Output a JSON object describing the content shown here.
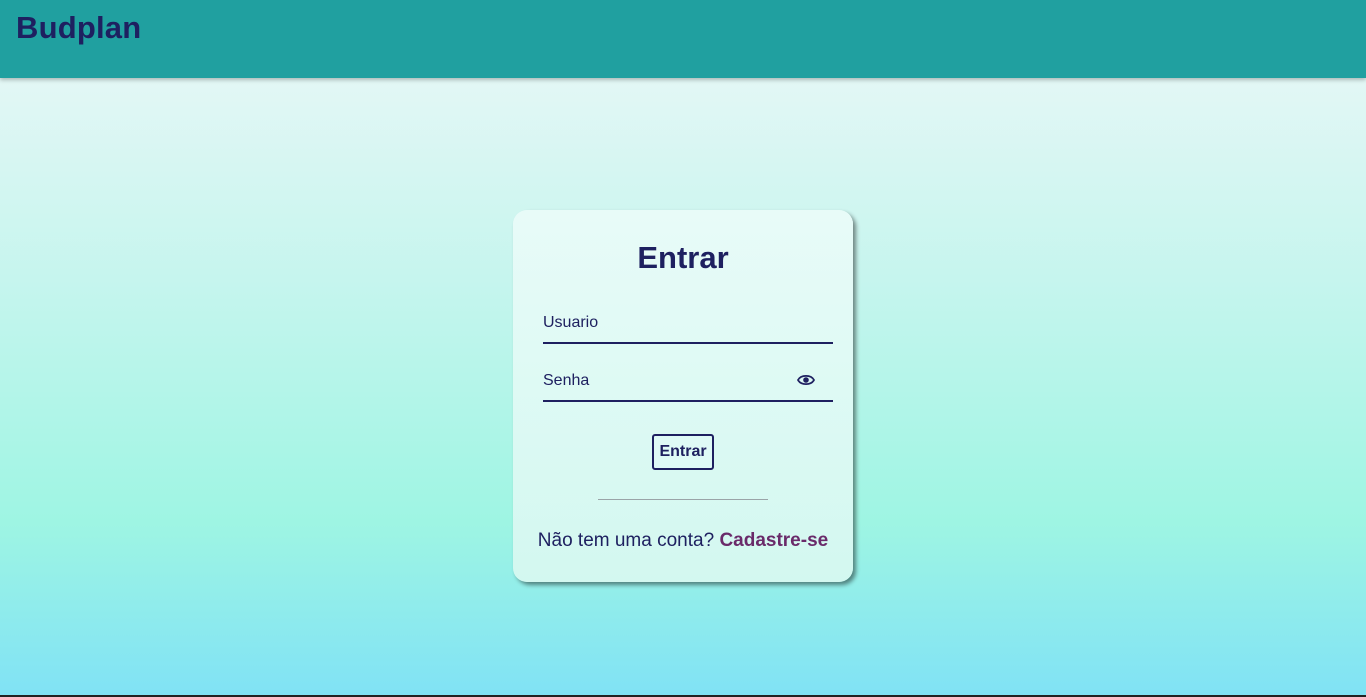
{
  "app": {
    "brand": "Budplan"
  },
  "login": {
    "title": "Entrar",
    "username_placeholder": "Usuario",
    "username_value": "",
    "password_placeholder": "Senha",
    "password_value": "",
    "show_password_icon": "eye-icon",
    "submit_label": "Entrar",
    "signup_prompt": "Não tem uma conta?",
    "signup_link": "Cadastre-se"
  },
  "colors": {
    "header_bg": "#20a0a0",
    "brand_text": "#1e2060",
    "accent_link": "#6a2a6a"
  }
}
